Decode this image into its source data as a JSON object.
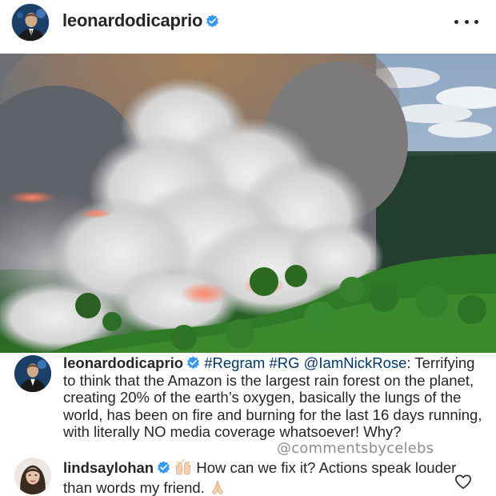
{
  "header": {
    "username": "leonardodicaprio",
    "verified_icon": "verified-badge-icon",
    "more_icon": "more-options-icon"
  },
  "post": {
    "image_description_icon": "forest-fire-photo"
  },
  "caption": {
    "username": "leonardodicaprio",
    "tags": [
      "#Regram",
      "#RG",
      "@IamNickRose"
    ],
    "text": "Terrifying to think that the Amazon is the largest rain forest on the planet, creating 20% of the earth’s oxygen, basically the lungs of the world, has been on fire and burning for the last 16 days running, with literally NO media coverage whatsoever! Why?"
  },
  "watermark": "@commentsbycelebs",
  "reply": {
    "username": "lindsaylohan",
    "emoji_before": "🙌🏼",
    "text": "How can we fix it? Actions speak louder than words my friend.",
    "emoji_after": "🙏🏼",
    "like_icon": "heart-outline-icon"
  },
  "colors": {
    "verified": "#3897f0",
    "text": "#262626",
    "hashtag": "#00376b",
    "watermark": "#8e8e8e"
  }
}
